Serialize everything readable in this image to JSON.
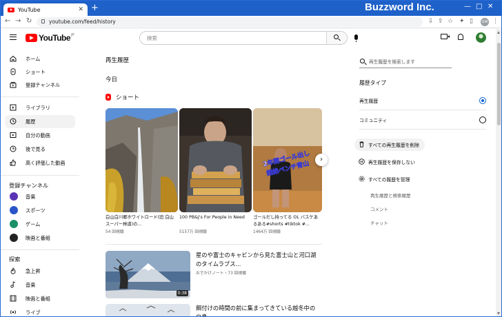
{
  "browser": {
    "tab_title": "YouTube",
    "tab_close": "✕",
    "new_tab": "+",
    "brand_watermark": "Buzzword Inc.",
    "url": "youtube.com/feed/history",
    "profile_initials": "GW"
  },
  "header": {
    "logo_text": "YouTube",
    "logo_region": "JP",
    "search_placeholder": "検索"
  },
  "sidebar": {
    "main": [
      {
        "label": "ホーム",
        "icon": "home-icon"
      },
      {
        "label": "ショート",
        "icon": "shorts-icon"
      },
      {
        "label": "登録チャンネル",
        "icon": "subscriptions-icon"
      }
    ],
    "library": [
      {
        "label": "ライブラリ",
        "icon": "library-icon"
      },
      {
        "label": "履歴",
        "icon": "history-icon",
        "active": true
      },
      {
        "label": "自分の動画",
        "icon": "my-videos-icon"
      },
      {
        "label": "後で見る",
        "icon": "watch-later-icon"
      },
      {
        "label": "高く評価した動画",
        "icon": "liked-icon"
      }
    ],
    "subscriptions_heading": "登録チャンネル",
    "subscriptions": [
      {
        "label": "音楽",
        "color": "#5b33b5"
      },
      {
        "label": "スポーツ",
        "color": "#2a55c9"
      },
      {
        "label": "ゲーム",
        "color": "#1c8f6a"
      },
      {
        "label": "映画と番組",
        "color": "#222222"
      }
    ],
    "explore_heading": "探索",
    "explore": [
      {
        "label": "急上昇",
        "icon": "trending-icon"
      },
      {
        "label": "音楽",
        "icon": "music-icon"
      },
      {
        "label": "映画と番組",
        "icon": "movies-icon"
      },
      {
        "label": "ライブ",
        "icon": "live-icon"
      }
    ]
  },
  "main": {
    "page_title": "再生履歴",
    "section_today": "今日",
    "shorts_heading": "ショート",
    "shorts": [
      {
        "title": "白山白川郷ホワイトロード(旧 白山スーパー林道)の...",
        "meta": "54 回視聴"
      },
      {
        "title": "100 PB&J's For People in Need",
        "meta": "5157万 回視聴"
      },
      {
        "title": "ゴールだし持ってる OL バスケあるある#shorts #tiktok #...",
        "meta": "1464万 回視聴",
        "overlay": "2年間ゴール出し 超絶ペンチ青山"
      }
    ],
    "next_icon": "›",
    "videos": [
      {
        "title": "星のや富士のキャビンから見た富士山と河口湖のタイムラプス...",
        "meta": "おでかけノート・73 回視聴",
        "duration": "0:38"
      },
      {
        "title": "餌付けの時間の前に集まってきている越冬中の白鳥",
        "meta": "",
        "duration": ""
      }
    ]
  },
  "panel": {
    "search_placeholder": "再生履歴を検索します",
    "type_label": "履歴タイプ",
    "types": [
      {
        "label": "再生履歴",
        "selected": true
      },
      {
        "label": "コミュニティ",
        "selected": false
      }
    ],
    "actions": [
      {
        "label": "すべての再生履歴を削除",
        "icon": "trash-icon"
      },
      {
        "label": "再生履歴を保存しない",
        "icon": "pause-icon"
      },
      {
        "label": "すべての履歴を管理",
        "icon": "settings-icon"
      }
    ],
    "sub_links": [
      "再生履歴と検索履歴",
      "コメント",
      "チャット"
    ]
  },
  "colors": {
    "brand_red": "#ff0000",
    "chrome_blue": "#1e61c9",
    "radio_blue": "#065fd4"
  }
}
